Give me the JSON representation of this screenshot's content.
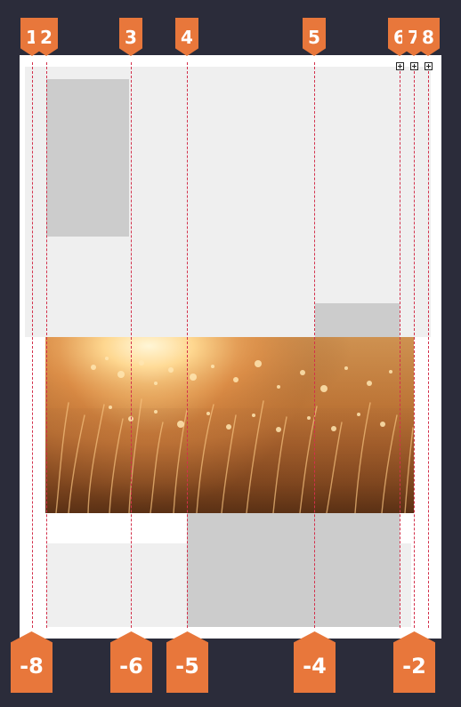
{
  "top_markers": [
    "1",
    "2",
    "3",
    "4",
    "5",
    "6",
    "7",
    "8"
  ],
  "bottom_markers": [
    "-8",
    "-6",
    "-5",
    "-4",
    "-2"
  ],
  "colors": {
    "background": "#2b2c3a",
    "page": "#ffffff",
    "panel": "#efefef",
    "placeholder": "#cccccc",
    "marker": "#e8773b",
    "guide": "#d3304b"
  }
}
